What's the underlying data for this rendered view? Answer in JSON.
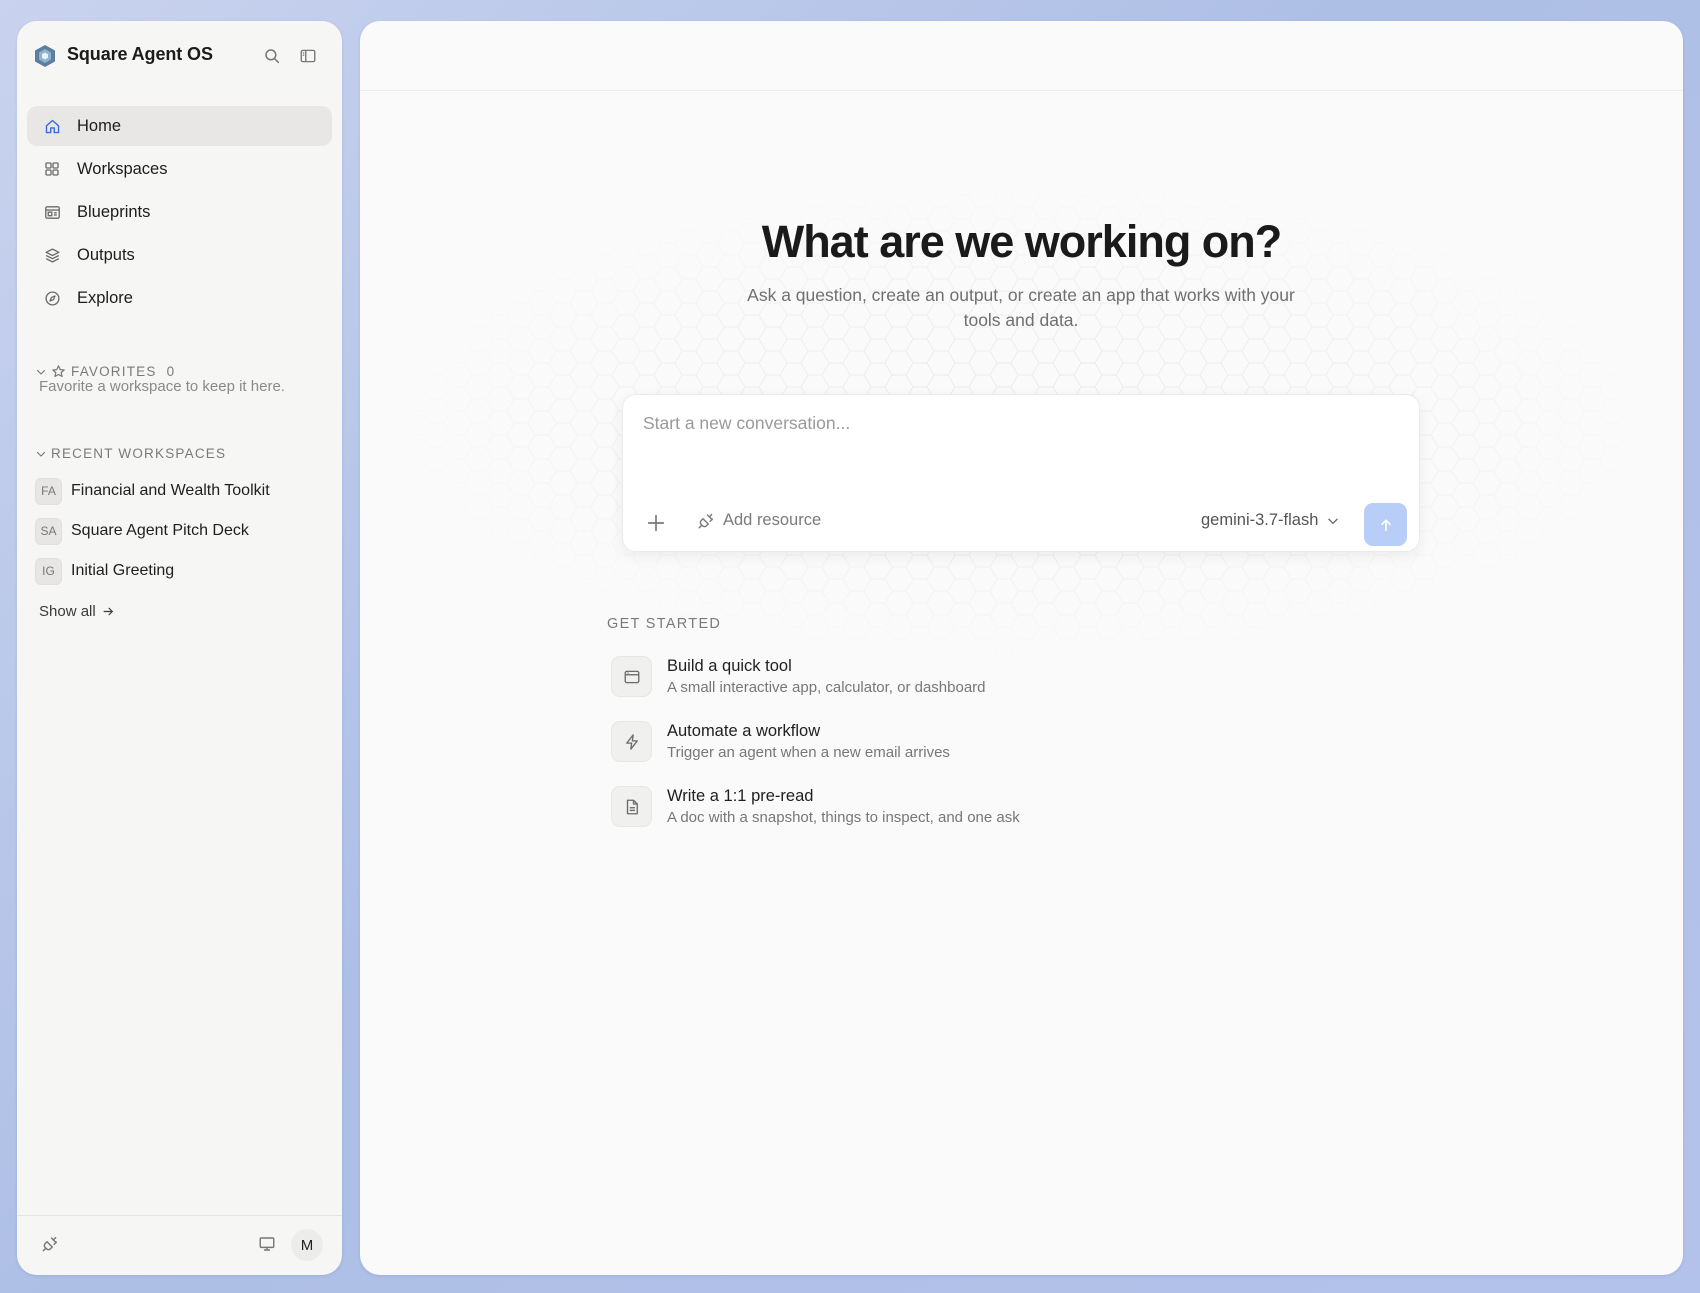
{
  "app": {
    "title": "Square Agent OS"
  },
  "nav": {
    "items": [
      {
        "label": "Home",
        "icon": "home-icon",
        "active": true
      },
      {
        "label": "Workspaces",
        "icon": "grid-icon"
      },
      {
        "label": "Blueprints",
        "icon": "blueprint-icon"
      },
      {
        "label": "Outputs",
        "icon": "layers-icon"
      },
      {
        "label": "Explore",
        "icon": "compass-icon"
      }
    ]
  },
  "favorites": {
    "title": "FAVORITES",
    "count": "0",
    "empty_text": "Favorite a workspace to keep it here."
  },
  "recent": {
    "title": "RECENT WORKSPACES",
    "items": [
      {
        "initials": "FA",
        "name": "Financial and Wealth Toolkit"
      },
      {
        "initials": "SA",
        "name": "Square Agent Pitch Deck"
      },
      {
        "initials": "IG",
        "name": "Initial Greeting"
      }
    ],
    "show_all": "Show all"
  },
  "footer": {
    "avatar": "M"
  },
  "hero": {
    "title": "What are we working on?",
    "subtitle": "Ask a question, create an output, or create an app that works with your tools and data."
  },
  "composer": {
    "placeholder": "Start a new conversation...",
    "add_resource": "Add resource",
    "model": "gemini-3.7-flash"
  },
  "get_started": {
    "title": "GET STARTED",
    "items": [
      {
        "title": "Build a quick tool",
        "desc": "A small interactive app, calculator, or dashboard",
        "icon": "app-window-icon"
      },
      {
        "title": "Automate a workflow",
        "desc": "Trigger an agent when a new email arrives",
        "icon": "lightning-icon"
      },
      {
        "title": "Write a 1:1 pre-read",
        "desc": "A doc with a snapshot, things to inspect, and one ask",
        "icon": "document-icon"
      }
    ]
  },
  "colors": {
    "accent": "#b8cdf7",
    "sidebar_bg": "#f6f6f5",
    "main_bg": "#fafafa"
  }
}
